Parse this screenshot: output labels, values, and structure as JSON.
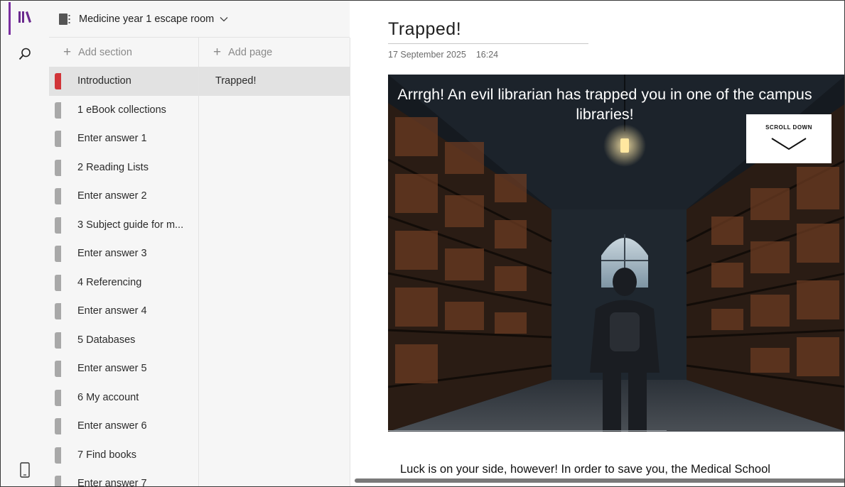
{
  "notebook": {
    "title": "Medicine year 1 escape room"
  },
  "sections_pane": {
    "add_label": "Add section",
    "items": [
      {
        "label": "Introduction",
        "selected": true,
        "tab_color": "#d13438"
      },
      {
        "label": "1 eBook collections",
        "tab_color": "#a8a8a8"
      },
      {
        "label": "Enter answer 1",
        "tab_color": "#a8a8a8"
      },
      {
        "label": "2 Reading Lists",
        "tab_color": "#a8a8a8"
      },
      {
        "label": "Enter answer 2",
        "tab_color": "#a8a8a8"
      },
      {
        "label": "3 Subject guide for m...",
        "tab_color": "#a8a8a8"
      },
      {
        "label": "Enter answer 3",
        "tab_color": "#a8a8a8"
      },
      {
        "label": "4 Referencing",
        "tab_color": "#a8a8a8"
      },
      {
        "label": "Enter answer 4",
        "tab_color": "#a8a8a8"
      },
      {
        "label": "5 Databases",
        "tab_color": "#a8a8a8"
      },
      {
        "label": "Enter answer 5",
        "tab_color": "#a8a8a8"
      },
      {
        "label": "6 My account",
        "tab_color": "#a8a8a8"
      },
      {
        "label": "Enter answer 6",
        "tab_color": "#a8a8a8"
      },
      {
        "label": "7 Find books",
        "tab_color": "#a8a8a8"
      },
      {
        "label": "Enter answer 7",
        "tab_color": "#a8a8a8"
      }
    ]
  },
  "pages_pane": {
    "add_label": "Add page",
    "items": [
      {
        "label": "Trapped!",
        "selected": true
      }
    ]
  },
  "page": {
    "title": "Trapped!",
    "date": "17 September 2025",
    "time": "16:24",
    "hero_caption": "Arrrgh! An evil librarian has trapped you in one of the campus libraries!",
    "scroll_badge": "SCROLL DOWN",
    "body_text": "Luck is on your side, however! In order to save you, the Medical School"
  },
  "icons": {
    "rail_notebooks": "library-icon",
    "rail_search": "search-icon",
    "rail_device": "phone-icon",
    "notebook": "notebook-icon",
    "chevron": "chevron-down-icon"
  },
  "colors": {
    "accent": "#7a2fa0",
    "selected_tab": "#d13438",
    "tab_gray": "#a8a8a8"
  }
}
